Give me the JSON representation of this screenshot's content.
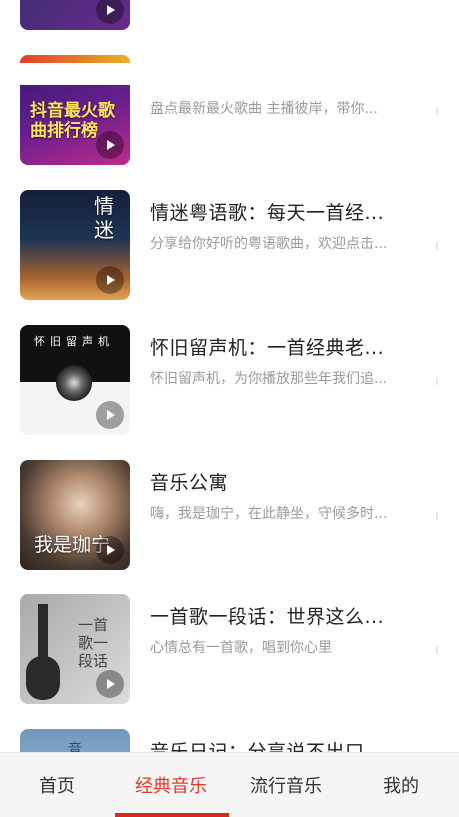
{
  "list": {
    "items": [
      {
        "title": "",
        "desc": "盘点最新最火歌曲 主播彼岸，带你...",
        "cover_text": "抖音最火歌曲排行榜",
        "colors": [
          "#3a1d7a",
          "#c02a8a"
        ]
      },
      {
        "title": "情迷粤语歌：每天一首经...",
        "desc": "分享给你好听的粤语歌曲，欢迎点击...",
        "cover_text": "情迷",
        "colors": [
          "#1c2a44",
          "#c67a3a"
        ]
      },
      {
        "title": "怀旧留声机：一首经典老...",
        "desc": "怀旧留声机，为你播放那些年我们追...",
        "cover_text": "怀旧留声机",
        "colors": [
          "#121212",
          "#e8e8e8"
        ]
      },
      {
        "title": "音乐公寓",
        "desc": "嗨，我是珈宁，在此静坐，守候多时...",
        "cover_text": "我是珈宁",
        "colors": [
          "#5a4a3e",
          "#c7b3a0"
        ]
      },
      {
        "title": "一首歌一段话：世界这么...",
        "desc": "心情总有一首歌，唱到你心里",
        "cover_text": "一首歌一段话",
        "colors": [
          "#b8b8b8",
          "#dedede"
        ]
      },
      {
        "title": "音乐日记：分享说不出口...",
        "desc": "",
        "cover_text": "音",
        "colors": [
          "#7ea2c4",
          "#b9d0e3"
        ]
      }
    ]
  },
  "tabbar": {
    "tabs": [
      {
        "label": "首页"
      },
      {
        "label": "经典音乐"
      },
      {
        "label": "流行音乐"
      },
      {
        "label": "我的"
      }
    ],
    "active_index": 1,
    "accent_color": "#d9281c"
  }
}
